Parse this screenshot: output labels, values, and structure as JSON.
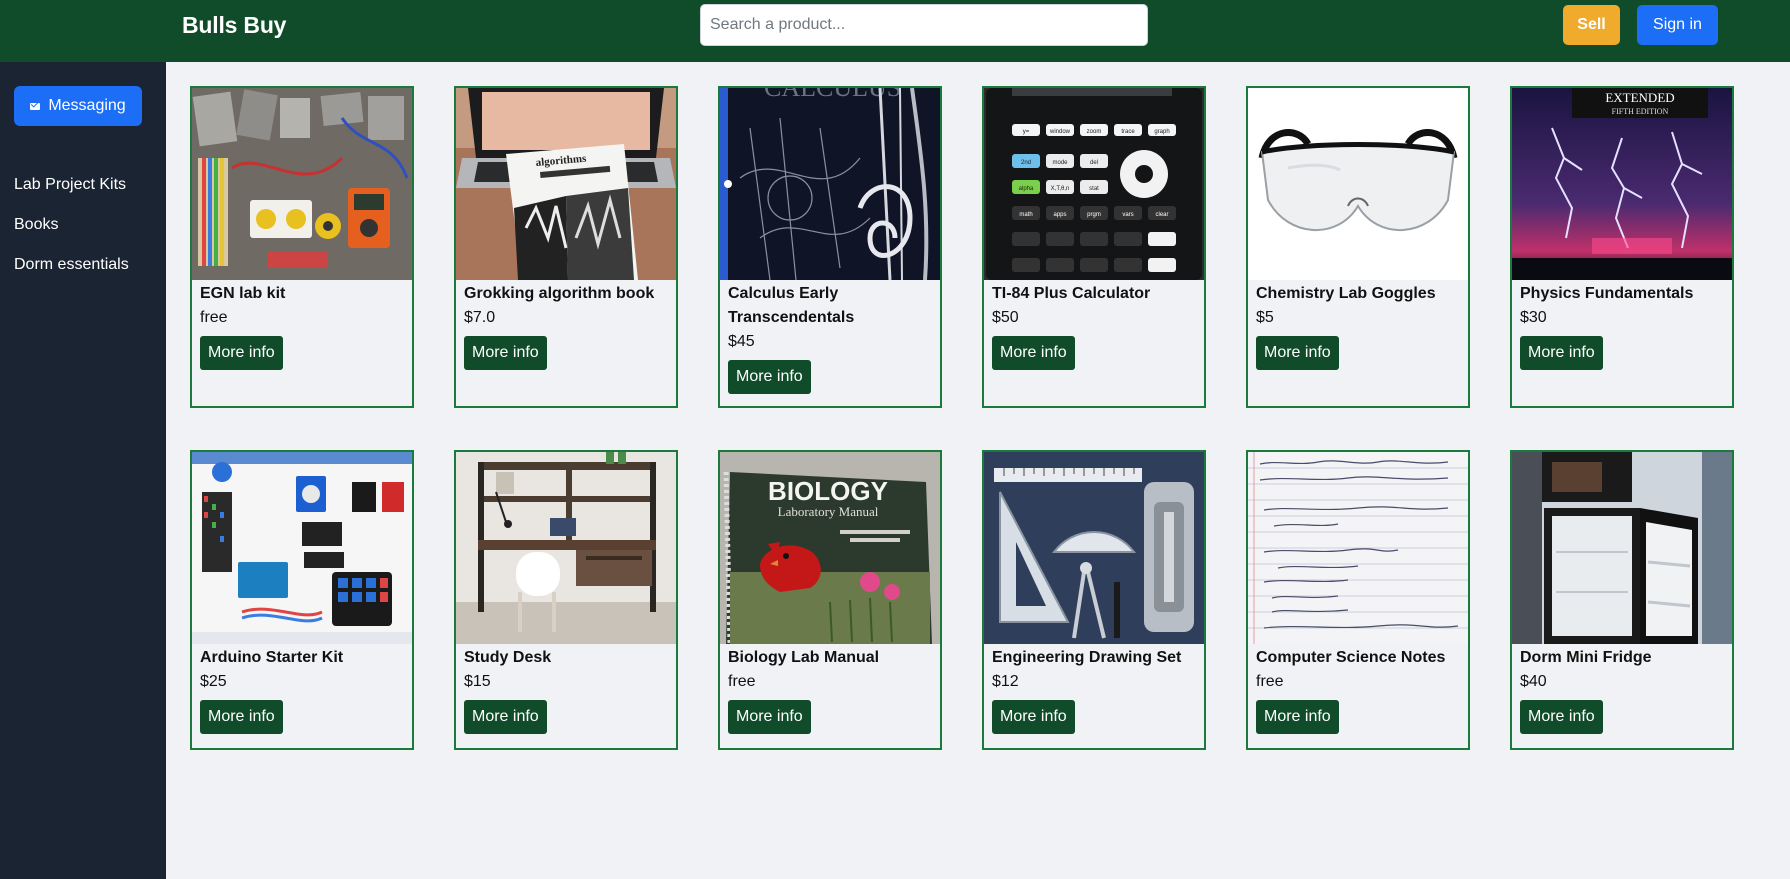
{
  "header": {
    "brand": "Bulls Buy",
    "search_placeholder": "Search a product...",
    "sell_label": "Sell",
    "signin_label": "Sign in"
  },
  "sidebar": {
    "messaging_label": "Messaging",
    "items": [
      {
        "label": "Lab Project Kits"
      },
      {
        "label": "Books"
      },
      {
        "label": "Dorm essentials"
      }
    ]
  },
  "products": [
    {
      "name": "EGN lab kit",
      "price": "free",
      "action": "More info",
      "image": "electronics-kit-photo"
    },
    {
      "name": "Grokking algorithm book",
      "price": "$7.0",
      "action": "More info",
      "image": "book-on-laptop-photo"
    },
    {
      "name": "Calculus Early Transcendentals",
      "price": "$45",
      "action": "More info",
      "image": "calculus-textbook-cover"
    },
    {
      "name": "TI-84 Plus Calculator",
      "price": "$50",
      "action": "More info",
      "image": "graphing-calculator-photo"
    },
    {
      "name": "Chemistry Lab Goggles",
      "price": "$5",
      "action": "More info",
      "image": "safety-goggles-photo"
    },
    {
      "name": "Physics Fundamentals",
      "price": "$30",
      "action": "More info",
      "image": "physics-book-lightning-cover"
    },
    {
      "name": "Arduino Starter Kit",
      "price": "$25",
      "action": "More info",
      "image": "arduino-kit-photo"
    },
    {
      "name": "Study Desk",
      "price": "$15",
      "action": "More info",
      "image": "study-desk-photo"
    },
    {
      "name": "Biology Lab Manual",
      "price": "free",
      "action": "More info",
      "image": "biology-manual-cardinal-cover"
    },
    {
      "name": "Engineering Drawing Set",
      "price": "$12",
      "action": "More info",
      "image": "drawing-tools-photo"
    },
    {
      "name": "Computer Science Notes",
      "price": "free",
      "action": "More info",
      "image": "handwritten-notes-photo"
    },
    {
      "name": "Dorm Mini Fridge",
      "price": "$40",
      "action": "More info",
      "image": "mini-fridge-photo"
    }
  ],
  "image_text": {
    "calculus": "CALCULUS",
    "physics": "EXTENDED",
    "physics_sub": "FIFTH EDITION",
    "biology": "BIOLOGY",
    "biology_sub": "Laboratory Manual",
    "grokking": "algorithms",
    "calc_keys": [
      "y=",
      "window",
      "zoom",
      "trace",
      "graph",
      "2nd",
      "mode",
      "del",
      "alpha",
      "X,T,θ,n",
      "stat",
      "math",
      "apps",
      "prgm",
      "vars",
      "clear"
    ]
  },
  "colors": {
    "navbar": "#104c2a",
    "sidebar": "#1b2432",
    "card_border": "#1a7a3c",
    "sell": "#f0aa2c",
    "primary": "#1b6ef5"
  }
}
